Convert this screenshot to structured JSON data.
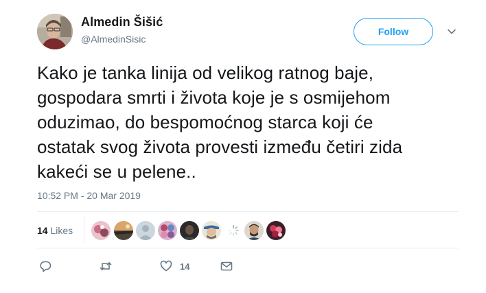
{
  "author": {
    "display_name": "Almedin Šišić",
    "handle": "@AlmedinSisic"
  },
  "follow_button": {
    "label": "Follow"
  },
  "tweet": {
    "lines": [
      "Kako je tanka linija od velikog ratnog baje,",
      "gospodara smrti i života koje je s osmijehom",
      "oduzimao, do bespomoćnog starca koji će",
      "ostatak svog života provesti između četiri zida",
      "kakeći se u pelene.."
    ],
    "timestamp": "10:52 PM - 20 Mar 2019"
  },
  "likes": {
    "count": "14",
    "label": "Likes"
  },
  "actions": {
    "reply_count": "",
    "retweet_count": "",
    "like_count": "14"
  },
  "colors": {
    "accent": "#1da1f2",
    "text": "#14171a",
    "secondary": "#657786",
    "divider": "#e6ecf0"
  }
}
